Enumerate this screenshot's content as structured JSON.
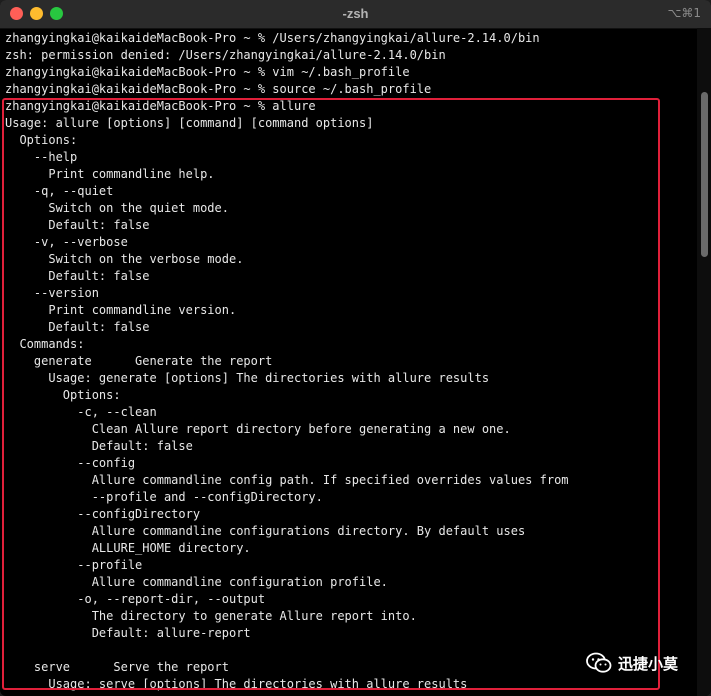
{
  "window": {
    "title": "-zsh",
    "shortcut": "⌥⌘1"
  },
  "terminal": {
    "lines": [
      "zhangyingkai@kaikaideMacBook-Pro ~ % /Users/zhangyingkai/allure-2.14.0/bin",
      "zsh: permission denied: /Users/zhangyingkai/allure-2.14.0/bin",
      "zhangyingkai@kaikaideMacBook-Pro ~ % vim ~/.bash_profile",
      "zhangyingkai@kaikaideMacBook-Pro ~ % source ~/.bash_profile",
      "zhangyingkai@kaikaideMacBook-Pro ~ % allure",
      "Usage: allure [options] [command] [command options]",
      "  Options:",
      "    --help",
      "      Print commandline help.",
      "    -q, --quiet",
      "      Switch on the quiet mode.",
      "      Default: false",
      "    -v, --verbose",
      "      Switch on the verbose mode.",
      "      Default: false",
      "    --version",
      "      Print commandline version.",
      "      Default: false",
      "  Commands:",
      "    generate      Generate the report",
      "      Usage: generate [options] The directories with allure results",
      "        Options:",
      "          -c, --clean",
      "            Clean Allure report directory before generating a new one.",
      "            Default: false",
      "          --config",
      "            Allure commandline config path. If specified overrides values from",
      "            --profile and --configDirectory.",
      "          --configDirectory",
      "            Allure commandline configurations directory. By default uses",
      "            ALLURE_HOME directory.",
      "          --profile",
      "            Allure commandline configuration profile.",
      "          -o, --report-dir, --output",
      "            The directory to generate Allure report into.",
      "            Default: allure-report",
      "",
      "    serve      Serve the report",
      "      Usage: serve [options] The directories with allure results"
    ]
  },
  "watermark": {
    "text": "迅捷小莫",
    "icon": "wechat-icon"
  },
  "colors": {
    "highlight_border": "#e0203a",
    "terminal_bg": "#000000",
    "terminal_text": "#e8e8e8"
  }
}
